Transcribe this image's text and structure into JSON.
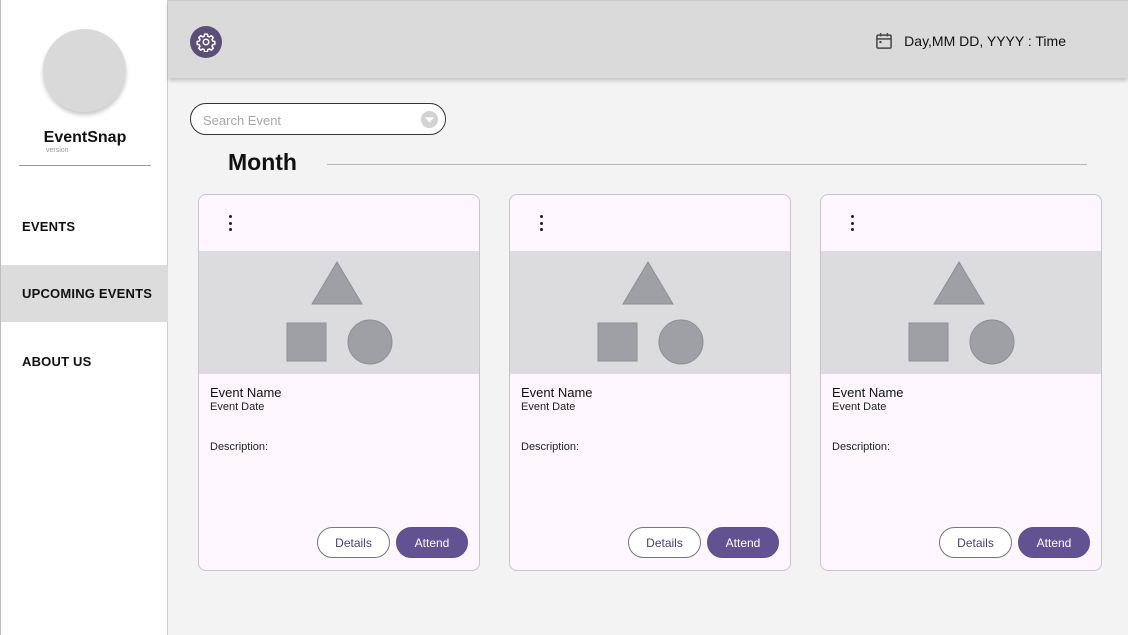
{
  "sidebar": {
    "brand": "EventSnap",
    "version": "version",
    "items": [
      {
        "label": "EVENTS",
        "active": false
      },
      {
        "label": "UPCOMING EVENTS",
        "active": true
      },
      {
        "label": "ABOUT US",
        "active": false
      }
    ]
  },
  "header": {
    "settings_icon": "gear-icon",
    "calendar_icon": "calendar-icon",
    "datetime": "Day,MM DD, YYYY : Time"
  },
  "search": {
    "placeholder": "Search Event",
    "value": ""
  },
  "section": {
    "title": "Month"
  },
  "cards": [
    {
      "name": "Event Name",
      "date": "Event Date",
      "description": "Description:",
      "details_label": "Details",
      "attend_label": "Attend"
    },
    {
      "name": "Event Name",
      "date": "Event Date",
      "description": "Description:",
      "details_label": "Details",
      "attend_label": "Attend"
    },
    {
      "name": "Event Name",
      "date": "Event Date",
      "description": "Description:",
      "details_label": "Details",
      "attend_label": "Attend"
    }
  ],
  "colors": {
    "accent": "#625291",
    "card_bg": "#fdf7fd",
    "active_nav": "#dcdcdc",
    "header_bg": "#dadada"
  }
}
